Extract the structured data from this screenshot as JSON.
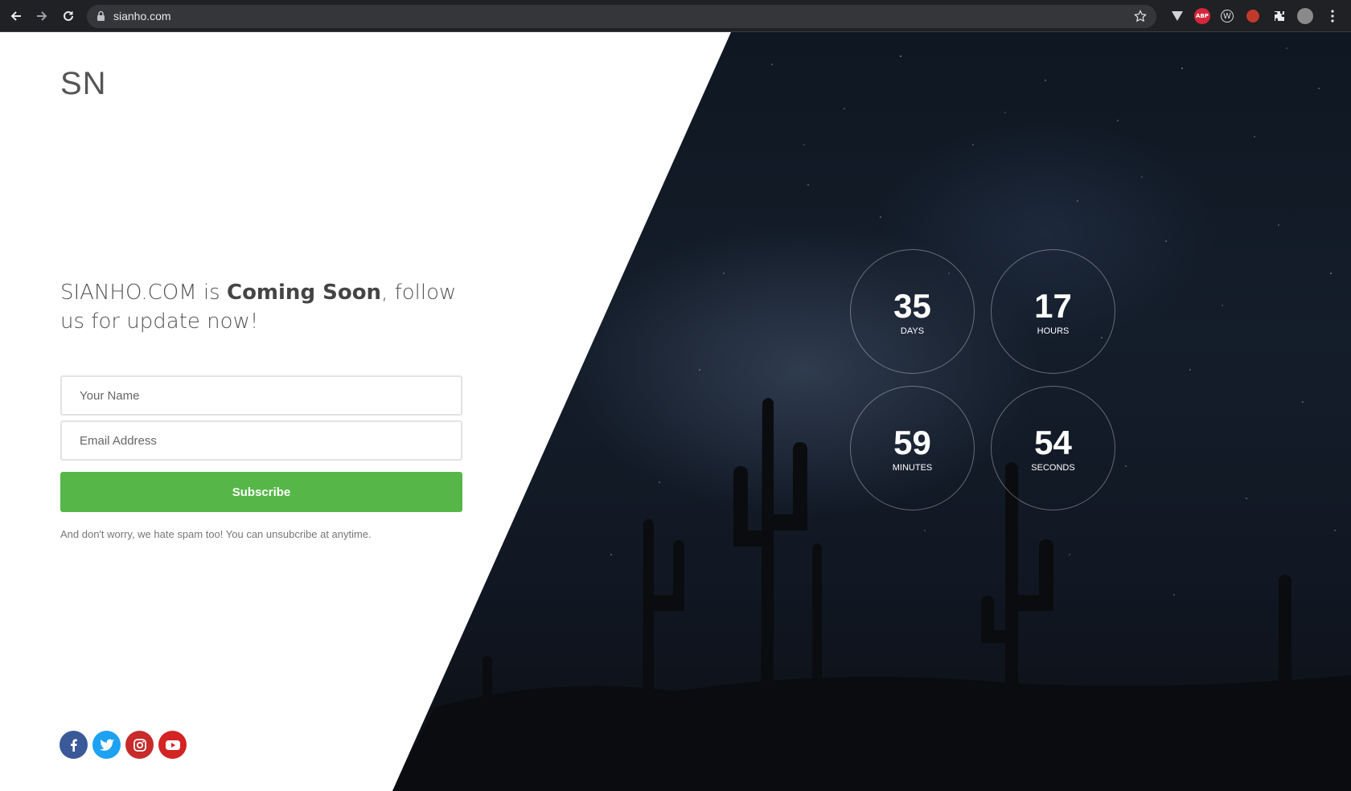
{
  "browser": {
    "url": "sianho.com",
    "extensions": [
      "vivaldi-icon",
      "adblock-plus-icon",
      "w-icon",
      "red-extension-icon",
      "puzzle-icon",
      "profile-avatar"
    ]
  },
  "page": {
    "logo": "SN",
    "headline": {
      "prefix": "SIANHO.COM is ",
      "bold": "Coming Soon",
      "suffix": ", follow us for update now!"
    },
    "form": {
      "name_placeholder": "Your Name",
      "email_placeholder": "Email Address",
      "subscribe_label": "Subscribe",
      "note": "And don't worry, we hate spam too! You can unsubcribe at anytime."
    },
    "social": [
      "facebook",
      "twitter",
      "instagram",
      "youtube"
    ],
    "countdown": {
      "days": {
        "value": "35",
        "label": "DAYS"
      },
      "hours": {
        "value": "17",
        "label": "HOURS"
      },
      "minutes": {
        "value": "59",
        "label": "MINUTES"
      },
      "seconds": {
        "value": "54",
        "label": "SECONDS"
      }
    },
    "colors": {
      "subscribe": "#56b748",
      "facebook": "#3b5998",
      "twitter": "#1da1f2",
      "instagram": "#c82b2b",
      "youtube": "#d32323"
    }
  }
}
